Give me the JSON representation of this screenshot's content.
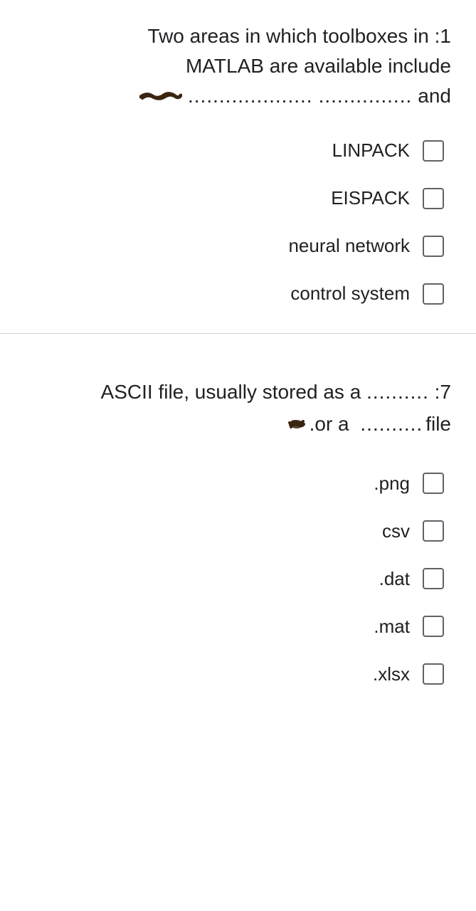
{
  "q1": {
    "number": ":1",
    "line1": "Two areas in which toolboxes in",
    "line2": "MATLAB are available include",
    "dots1": "....................",
    "dots2": "...............",
    "and": "and",
    "options": [
      "LINPACK",
      "EISPACK",
      "neural network",
      "control system"
    ]
  },
  "q2": {
    "number": ":7",
    "line1_pre": "ASCII file, usually stored as a",
    "dots1": "..........",
    "or_a": ".or a",
    "dots2": "..........",
    "file": "file",
    "options": [
      ".png",
      "csv",
      ".dat",
      ".mat",
      ".xlsx"
    ]
  }
}
